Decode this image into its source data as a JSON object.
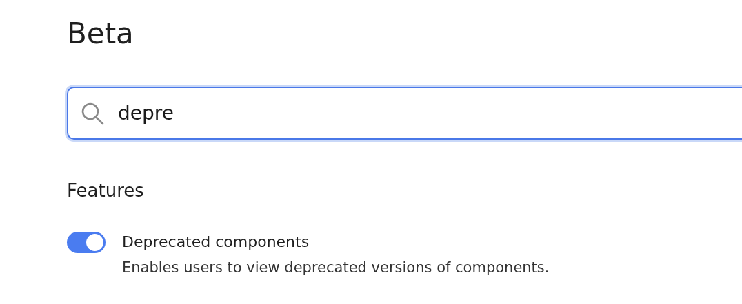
{
  "page_title": "Beta",
  "search": {
    "value": "depre"
  },
  "section_title": "Features",
  "features": [
    {
      "name": "Deprecated components",
      "description": "Enables users to view deprecated versions of components.",
      "on": true
    }
  ]
}
